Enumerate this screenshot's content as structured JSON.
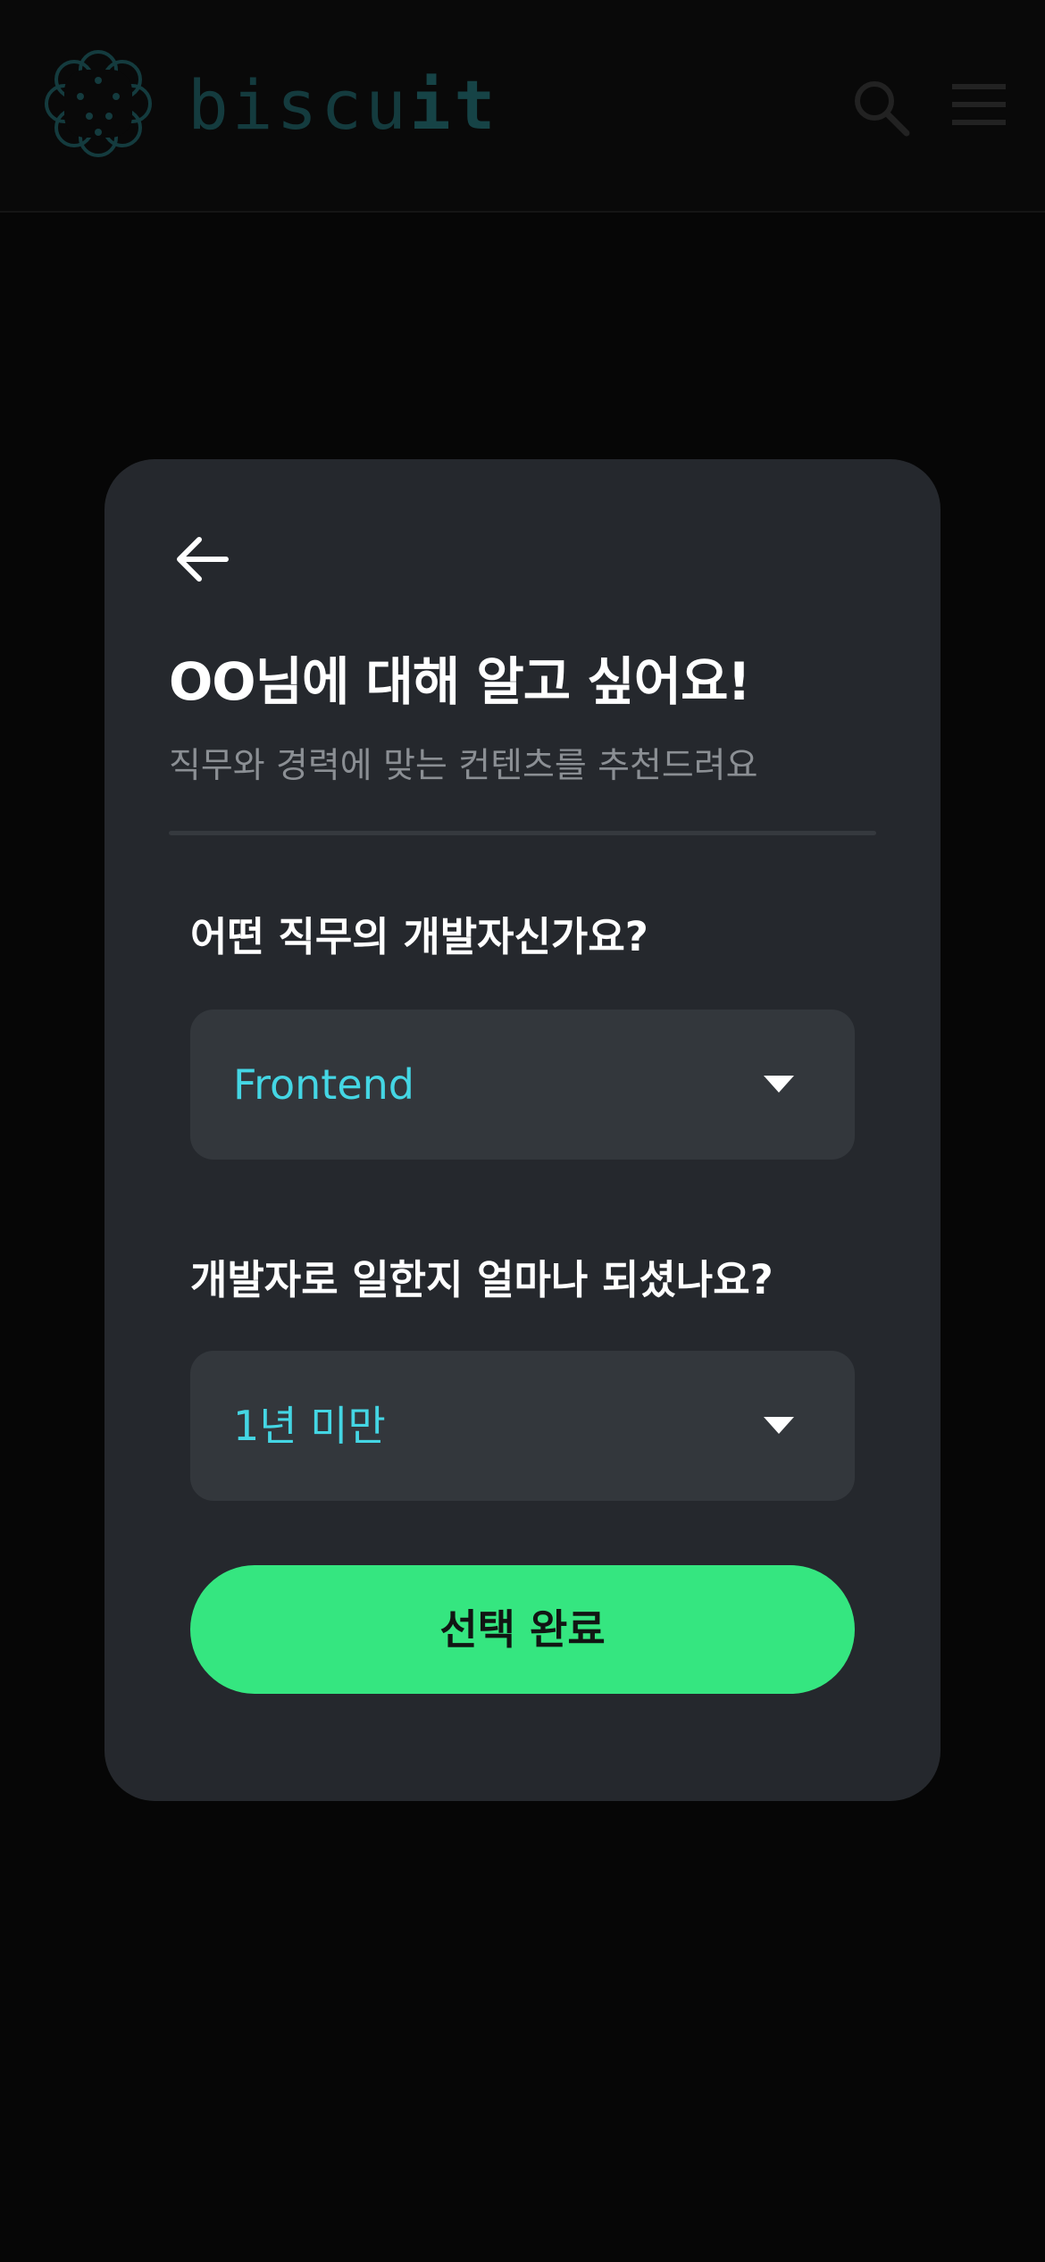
{
  "header": {
    "logo_text_light": "biscu",
    "logo_text_bold": "it",
    "logo_icon": "cookie-logo-icon",
    "search_icon": "search-icon",
    "menu_icon": "hamburger-menu-icon"
  },
  "modal": {
    "back_icon": "arrow-left-icon",
    "title": "OO님에 대해 알고 싶어요!",
    "subtitle": "직무와 경력에 맞는 컨텐츠를 추천드려요",
    "questions": [
      {
        "label": "어떤 직무의 개발자신가요?",
        "selected": "Frontend"
      },
      {
        "label": "개발자로 일한지 얼마나 되셨나요?",
        "selected": "1년 미만"
      }
    ],
    "submit_label": "선택 완료"
  },
  "colors": {
    "background": "#060606",
    "card": "#25282d",
    "select_bg": "#33373c",
    "accent_value": "#44d6e4",
    "primary_button": "#35e680",
    "logo": "#143b3e"
  }
}
